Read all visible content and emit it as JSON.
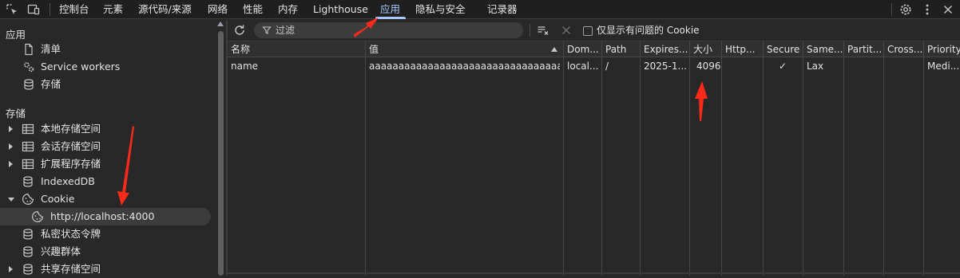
{
  "devtools": {
    "tabs": [
      {
        "label": "控制台"
      },
      {
        "label": "元素"
      },
      {
        "label": "源代码/来源"
      },
      {
        "label": "网络"
      },
      {
        "label": "性能"
      },
      {
        "label": "内存"
      },
      {
        "label": "Lighthouse"
      },
      {
        "label": "应用",
        "active": true
      },
      {
        "label": "隐私与安全"
      },
      {
        "label": "记录器"
      }
    ],
    "accent_color": "#a8c7fa"
  },
  "sidebar": {
    "application_title": "应用",
    "application_items": [
      {
        "label": "清单",
        "icon": "file-icon"
      },
      {
        "label": "Service workers",
        "icon": "gears-icon"
      },
      {
        "label": "存储",
        "icon": "database-icon"
      }
    ],
    "storage_title": "存储",
    "storage_items": [
      {
        "label": "本地存储空间",
        "icon": "table-icon",
        "expander": "collapsed"
      },
      {
        "label": "会话存储空间",
        "icon": "table-icon",
        "expander": "collapsed"
      },
      {
        "label": "扩展程序存储",
        "icon": "table-icon",
        "expander": "collapsed"
      },
      {
        "label": "IndexedDB",
        "icon": "database-icon"
      },
      {
        "label": "Cookie",
        "icon": "cookie-icon",
        "expander": "expanded"
      },
      {
        "label": "http://localhost:4000",
        "icon": "cookie-icon",
        "selected": true
      },
      {
        "label": "私密状态令牌",
        "icon": "database-icon"
      },
      {
        "label": "兴趣群体",
        "icon": "database-icon"
      },
      {
        "label": "共享存储空间",
        "icon": "database-icon",
        "expander": "collapsed"
      }
    ]
  },
  "toolbar": {
    "filter_placeholder": "过滤",
    "only_issues_label": "仅显示有问题的 Cookie",
    "only_issues_checked": false
  },
  "table": {
    "columns": [
      "名称",
      "值",
      "Dom...",
      "Path",
      "Expires...",
      "大小",
      "Http...",
      "Secure",
      "Same...",
      "Partit...",
      "Cross...",
      "Priority"
    ],
    "sorted_column": "值",
    "rows": [
      {
        "name": "name",
        "value": "aaaaaaaaaaaaaaaaaaaaaaaaaaaaaaaaaaa...",
        "domain": "local...",
        "path": "/",
        "expires": "2025-1...",
        "size": "4096",
        "httponly": "",
        "secure": "✓",
        "samesite": "Lax",
        "partition": "",
        "cross_site": "",
        "priority": "Medi..."
      }
    ]
  },
  "annotation_color": "#ff2a1a"
}
